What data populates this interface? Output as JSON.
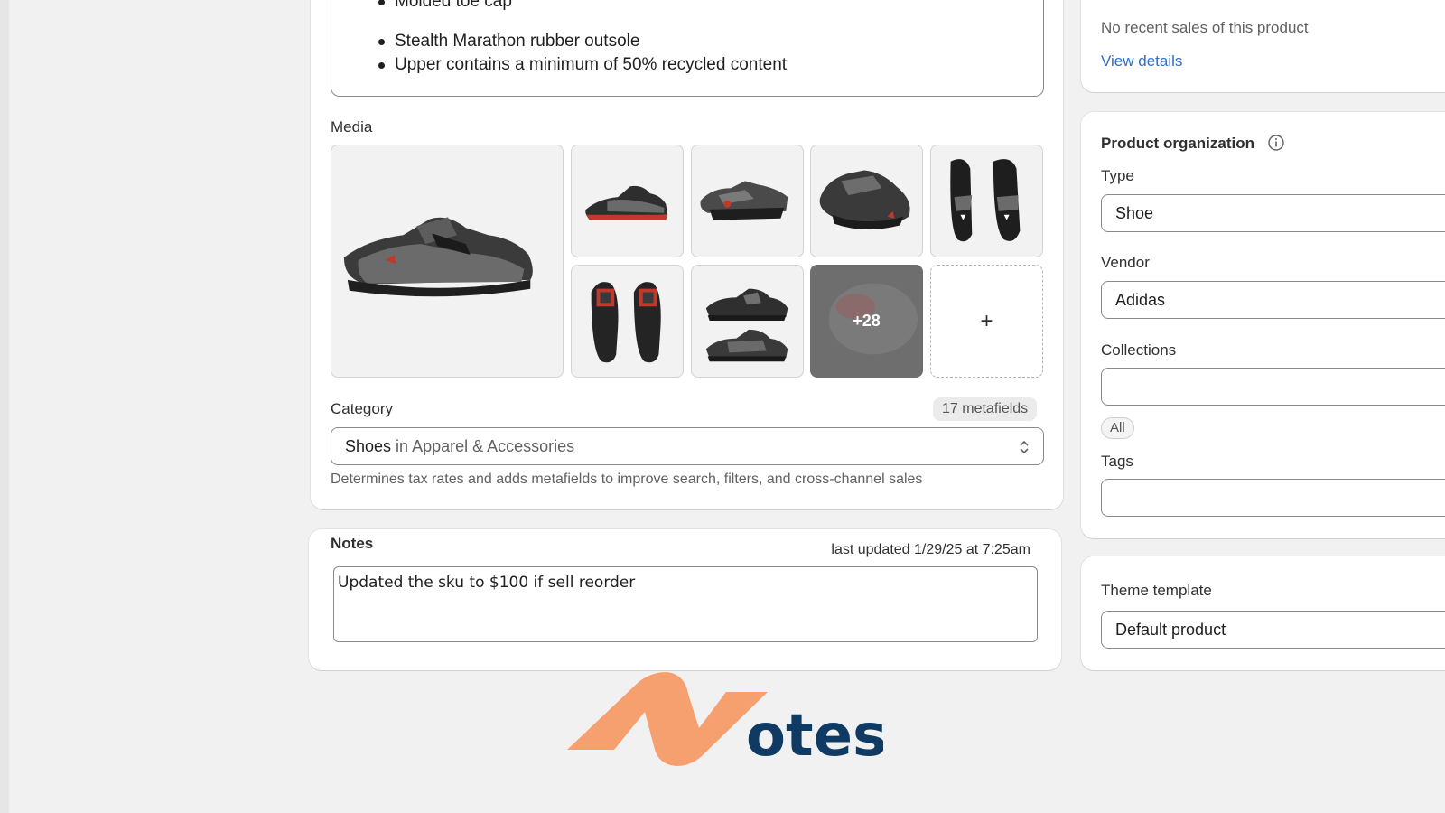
{
  "description": {
    "bullets_top": [
      "Molded toe cap"
    ],
    "bullets_bottom": [
      "Stealth Marathon rubber outsole",
      "Upper contains a minimum of 50% recycled content"
    ]
  },
  "media": {
    "label": "Media",
    "more_count": "+28",
    "add_label": "+"
  },
  "category": {
    "label": "Category",
    "metafields_badge": "17 metafields",
    "value": "Shoes",
    "value_suffix": "in Apparel & Accessories",
    "helper": "Determines tax rates and adds metafields to improve search, filters, and cross-channel sales"
  },
  "notes": {
    "title": "Notes",
    "last_updated": "last updated 1/29/25 at 7:25am",
    "text": "Updated the sku to $100 if sell reorder"
  },
  "sales": {
    "message": "No recent sales of this product",
    "link": "View details"
  },
  "product_organization": {
    "title": "Product organization",
    "type_label": "Type",
    "type_value": "Shoe",
    "vendor_label": "Vendor",
    "vendor_value": "Adidas",
    "collections_label": "Collections",
    "collections_value": "",
    "all_pill": "All",
    "tags_label": "Tags",
    "tags_value": ""
  },
  "theme": {
    "label": "Theme template",
    "value": "Default product"
  },
  "logo": {
    "text": "otes",
    "colors": {
      "mark": "#f5a06e",
      "text": "#0f3a64"
    }
  }
}
